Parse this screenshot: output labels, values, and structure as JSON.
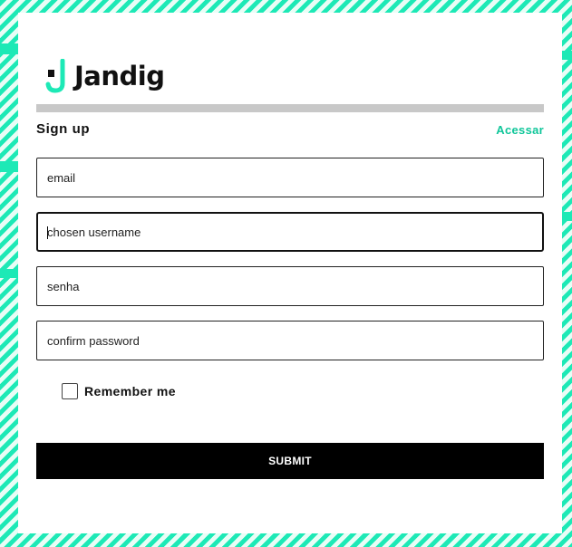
{
  "brand": {
    "name": "Jandig",
    "accent": "#1de9b6"
  },
  "form": {
    "title": "Sign up",
    "login_link": "Acessar",
    "email_placeholder": "email",
    "username_placeholder": "chosen username",
    "password_placeholder": "senha",
    "confirm_placeholder": "confirm password",
    "remember_label": "Remember me",
    "remember_checked": false,
    "submit_label": "SUBMIT"
  },
  "colors": {
    "link": "#10c69a",
    "button": "#000000",
    "divider": "#c8c8c8"
  }
}
